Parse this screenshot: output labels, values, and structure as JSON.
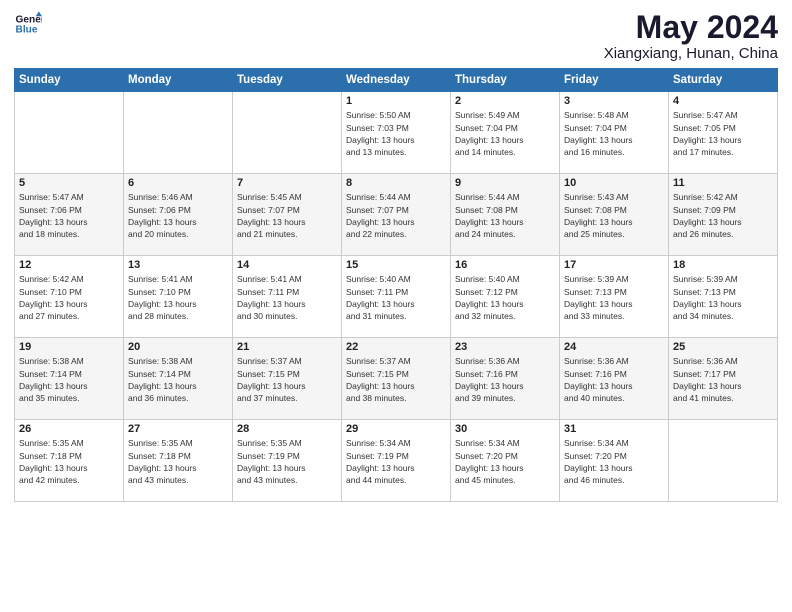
{
  "header": {
    "logo_line1": "General",
    "logo_line2": "Blue",
    "month_title": "May 2024",
    "location": "Xiangxiang, Hunan, China"
  },
  "days_of_week": [
    "Sunday",
    "Monday",
    "Tuesday",
    "Wednesday",
    "Thursday",
    "Friday",
    "Saturday"
  ],
  "weeks": [
    [
      {
        "day": "",
        "info": ""
      },
      {
        "day": "",
        "info": ""
      },
      {
        "day": "",
        "info": ""
      },
      {
        "day": "1",
        "info": "Sunrise: 5:50 AM\nSunset: 7:03 PM\nDaylight: 13 hours\nand 13 minutes."
      },
      {
        "day": "2",
        "info": "Sunrise: 5:49 AM\nSunset: 7:04 PM\nDaylight: 13 hours\nand 14 minutes."
      },
      {
        "day": "3",
        "info": "Sunrise: 5:48 AM\nSunset: 7:04 PM\nDaylight: 13 hours\nand 16 minutes."
      },
      {
        "day": "4",
        "info": "Sunrise: 5:47 AM\nSunset: 7:05 PM\nDaylight: 13 hours\nand 17 minutes."
      }
    ],
    [
      {
        "day": "5",
        "info": "Sunrise: 5:47 AM\nSunset: 7:06 PM\nDaylight: 13 hours\nand 18 minutes."
      },
      {
        "day": "6",
        "info": "Sunrise: 5:46 AM\nSunset: 7:06 PM\nDaylight: 13 hours\nand 20 minutes."
      },
      {
        "day": "7",
        "info": "Sunrise: 5:45 AM\nSunset: 7:07 PM\nDaylight: 13 hours\nand 21 minutes."
      },
      {
        "day": "8",
        "info": "Sunrise: 5:44 AM\nSunset: 7:07 PM\nDaylight: 13 hours\nand 22 minutes."
      },
      {
        "day": "9",
        "info": "Sunrise: 5:44 AM\nSunset: 7:08 PM\nDaylight: 13 hours\nand 24 minutes."
      },
      {
        "day": "10",
        "info": "Sunrise: 5:43 AM\nSunset: 7:08 PM\nDaylight: 13 hours\nand 25 minutes."
      },
      {
        "day": "11",
        "info": "Sunrise: 5:42 AM\nSunset: 7:09 PM\nDaylight: 13 hours\nand 26 minutes."
      }
    ],
    [
      {
        "day": "12",
        "info": "Sunrise: 5:42 AM\nSunset: 7:10 PM\nDaylight: 13 hours\nand 27 minutes."
      },
      {
        "day": "13",
        "info": "Sunrise: 5:41 AM\nSunset: 7:10 PM\nDaylight: 13 hours\nand 28 minutes."
      },
      {
        "day": "14",
        "info": "Sunrise: 5:41 AM\nSunset: 7:11 PM\nDaylight: 13 hours\nand 30 minutes."
      },
      {
        "day": "15",
        "info": "Sunrise: 5:40 AM\nSunset: 7:11 PM\nDaylight: 13 hours\nand 31 minutes."
      },
      {
        "day": "16",
        "info": "Sunrise: 5:40 AM\nSunset: 7:12 PM\nDaylight: 13 hours\nand 32 minutes."
      },
      {
        "day": "17",
        "info": "Sunrise: 5:39 AM\nSunset: 7:13 PM\nDaylight: 13 hours\nand 33 minutes."
      },
      {
        "day": "18",
        "info": "Sunrise: 5:39 AM\nSunset: 7:13 PM\nDaylight: 13 hours\nand 34 minutes."
      }
    ],
    [
      {
        "day": "19",
        "info": "Sunrise: 5:38 AM\nSunset: 7:14 PM\nDaylight: 13 hours\nand 35 minutes."
      },
      {
        "day": "20",
        "info": "Sunrise: 5:38 AM\nSunset: 7:14 PM\nDaylight: 13 hours\nand 36 minutes."
      },
      {
        "day": "21",
        "info": "Sunrise: 5:37 AM\nSunset: 7:15 PM\nDaylight: 13 hours\nand 37 minutes."
      },
      {
        "day": "22",
        "info": "Sunrise: 5:37 AM\nSunset: 7:15 PM\nDaylight: 13 hours\nand 38 minutes."
      },
      {
        "day": "23",
        "info": "Sunrise: 5:36 AM\nSunset: 7:16 PM\nDaylight: 13 hours\nand 39 minutes."
      },
      {
        "day": "24",
        "info": "Sunrise: 5:36 AM\nSunset: 7:16 PM\nDaylight: 13 hours\nand 40 minutes."
      },
      {
        "day": "25",
        "info": "Sunrise: 5:36 AM\nSunset: 7:17 PM\nDaylight: 13 hours\nand 41 minutes."
      }
    ],
    [
      {
        "day": "26",
        "info": "Sunrise: 5:35 AM\nSunset: 7:18 PM\nDaylight: 13 hours\nand 42 minutes."
      },
      {
        "day": "27",
        "info": "Sunrise: 5:35 AM\nSunset: 7:18 PM\nDaylight: 13 hours\nand 43 minutes."
      },
      {
        "day": "28",
        "info": "Sunrise: 5:35 AM\nSunset: 7:19 PM\nDaylight: 13 hours\nand 43 minutes."
      },
      {
        "day": "29",
        "info": "Sunrise: 5:34 AM\nSunset: 7:19 PM\nDaylight: 13 hours\nand 44 minutes."
      },
      {
        "day": "30",
        "info": "Sunrise: 5:34 AM\nSunset: 7:20 PM\nDaylight: 13 hours\nand 45 minutes."
      },
      {
        "day": "31",
        "info": "Sunrise: 5:34 AM\nSunset: 7:20 PM\nDaylight: 13 hours\nand 46 minutes."
      },
      {
        "day": "",
        "info": ""
      }
    ]
  ]
}
